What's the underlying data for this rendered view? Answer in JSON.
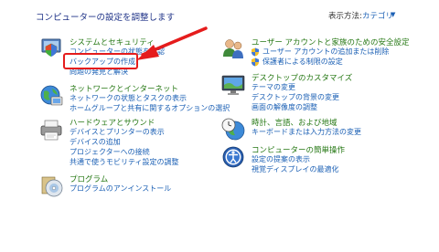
{
  "header": {
    "title": "コンピューターの設定を調整します",
    "view_label": "表示方法:",
    "view_value": "カテゴリ"
  },
  "left": [
    {
      "title": "システムとセキュリティ",
      "links": [
        "コンピューターの状態を確認",
        "バックアップの作成",
        "問題の発見と解決"
      ],
      "icon": "shield-computer-icon"
    },
    {
      "title": "ネットワークとインターネット",
      "links": [
        "ネットワークの状態とタスクの表示",
        "ホームグループと共有に関するオプションの選択"
      ],
      "icon": "network-globe-icon"
    },
    {
      "title": "ハードウェアとサウンド",
      "links": [
        "デバイスとプリンターの表示",
        "デバイスの追加",
        "プロジェクターへの接続",
        "共通で使うモビリティ設定の調整"
      ],
      "icon": "printer-icon"
    },
    {
      "title": "プログラム",
      "links": [
        "プログラムのアンインストール"
      ],
      "icon": "programs-disc-icon"
    }
  ],
  "right": [
    {
      "title": "ユーザー アカウントと家族のための安全設定",
      "links": [
        "ユーザー アカウントの追加または削除",
        "保護者による制限の設定"
      ],
      "icon": "users-icon"
    },
    {
      "title": "デスクトップのカスタマイズ",
      "links": [
        "テーマの変更",
        "デスクトップの背景の変更",
        "画面の解像度の調整"
      ],
      "icon": "desktop-monitor-icon"
    },
    {
      "title": "時計、言語、および地域",
      "links": [
        "キーボードまたは入力方法の変更"
      ],
      "icon": "clock-globe-icon"
    },
    {
      "title": "コンピューターの簡単操作",
      "links": [
        "設定の提案の表示",
        "視覚ディスプレイの最適化"
      ],
      "icon": "ease-of-access-icon"
    }
  ],
  "colors": {
    "title_green": "#267814",
    "link_blue": "#1a5fb4",
    "highlight_red": "#e51c1c"
  }
}
